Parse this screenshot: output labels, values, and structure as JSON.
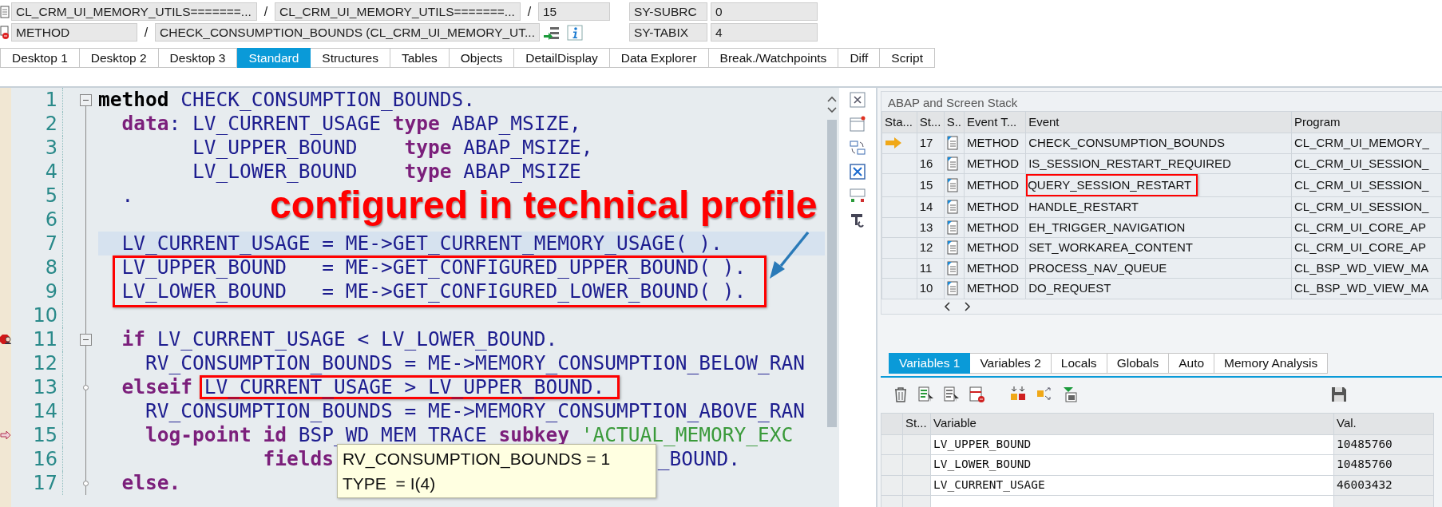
{
  "header": [
    {
      "items": [
        {
          "kind": "field",
          "text": "CL_CRM_UI_MEMORY_UTILS=======..."
        },
        {
          "kind": "sep",
          "text": "/"
        },
        {
          "kind": "field",
          "text": "CL_CRM_UI_MEMORY_UTILS=======..."
        },
        {
          "kind": "sep",
          "text": "/"
        },
        {
          "kind": "short",
          "text": "15"
        }
      ],
      "sys_label": "SY-SUBRC",
      "sys_value": "0"
    },
    {
      "items": [
        {
          "kind": "medium",
          "text": "METHOD"
        },
        {
          "kind": "sep",
          "text": "/"
        },
        {
          "kind": "wide",
          "text": "CHECK_CONSUMPTION_BOUNDS (CL_CRM_UI_MEMORY_UT..."
        },
        {
          "kind": "tools"
        }
      ],
      "sys_label": "SY-TABIX",
      "sys_value": "4"
    }
  ],
  "tabs": [
    {
      "label": "Desktop 1",
      "selected": false
    },
    {
      "label": "Desktop 2",
      "selected": false
    },
    {
      "label": "Desktop 3",
      "selected": false
    },
    {
      "label": "Standard",
      "selected": true
    },
    {
      "label": "Structures",
      "selected": false
    },
    {
      "label": "Tables",
      "selected": false
    },
    {
      "label": "Objects",
      "selected": false
    },
    {
      "label": "DetailDisplay",
      "selected": false
    },
    {
      "label": "Data Explorer",
      "selected": false
    },
    {
      "label": "Break./Watchpoints",
      "selected": false
    },
    {
      "label": "Diff",
      "selected": false
    },
    {
      "label": "Script",
      "selected": false
    }
  ],
  "code": {
    "lines": [
      {
        "num": "1",
        "current": false,
        "boxed": false,
        "fold_open": true,
        "fold_branch": false,
        "breakpoint": false,
        "logpoint": false,
        "segments": [
          {
            "kind": "kw0",
            "text": "method"
          },
          {
            "kind": "id",
            "text": " CHECK_CONSUMPTION_BOUNDS."
          }
        ]
      },
      {
        "num": "2",
        "current": false,
        "boxed": false,
        "fold_open": false,
        "fold_branch": false,
        "breakpoint": false,
        "logpoint": false,
        "segments": [
          {
            "kind": "kw",
            "text": "  data"
          },
          {
            "kind": "id",
            "text": ": LV_CURRENT_USAGE "
          },
          {
            "kind": "kw",
            "text": "type"
          },
          {
            "kind": "id",
            "text": " ABAP_MSIZE,"
          }
        ]
      },
      {
        "num": "3",
        "current": false,
        "boxed": false,
        "fold_open": false,
        "fold_branch": false,
        "breakpoint": false,
        "logpoint": false,
        "segments": [
          {
            "kind": "id",
            "text": "        LV_UPPER_BOUND    "
          },
          {
            "kind": "kw",
            "text": "type"
          },
          {
            "kind": "id",
            "text": " ABAP_MSIZE,"
          }
        ]
      },
      {
        "num": "4",
        "current": false,
        "boxed": false,
        "fold_open": false,
        "fold_branch": false,
        "breakpoint": false,
        "logpoint": false,
        "segments": [
          {
            "kind": "id",
            "text": "        LV_LOWER_BOUND    "
          },
          {
            "kind": "kw",
            "text": "type"
          },
          {
            "kind": "id",
            "text": " ABAP_MSIZE"
          }
        ]
      },
      {
        "num": "5",
        "current": false,
        "boxed": false,
        "fold_open": false,
        "fold_branch": false,
        "breakpoint": false,
        "logpoint": false,
        "segments": [
          {
            "kind": "id",
            "text": "  ."
          }
        ]
      },
      {
        "num": "6",
        "current": false,
        "boxed": false,
        "fold_open": false,
        "fold_branch": false,
        "breakpoint": false,
        "logpoint": false
      },
      {
        "num": "7",
        "current": true,
        "boxed": false,
        "fold_open": false,
        "fold_branch": false,
        "breakpoint": false,
        "logpoint": false,
        "segments": [
          {
            "kind": "id",
            "text": "  LV_CURRENT_USAGE = ME->GET_CURRENT_MEMORY_USAGE( )."
          }
        ]
      },
      {
        "num": "8",
        "current": false,
        "boxed": true,
        "fold_open": false,
        "fold_branch": false,
        "breakpoint": false,
        "logpoint": false,
        "segments": [
          {
            "kind": "id",
            "text": "  LV_UPPER_BOUND   = ME->GET_CONFIGURED_UPPER_BOUND( )."
          }
        ]
      },
      {
        "num": "9",
        "current": false,
        "boxed": true,
        "fold_open": false,
        "fold_branch": false,
        "breakpoint": false,
        "logpoint": false,
        "segments": [
          {
            "kind": "id",
            "text": "  LV_LOWER_BOUND   = ME->GET_CONFIGURED_LOWER_BOUND( )."
          }
        ]
      },
      {
        "num": "10",
        "current": false,
        "boxed": false,
        "fold_open": false,
        "fold_branch": false,
        "breakpoint": false,
        "logpoint": false
      },
      {
        "num": "11",
        "current": false,
        "boxed": false,
        "fold_open": true,
        "fold_branch": false,
        "breakpoint": true,
        "logpoint": false,
        "segments": [
          {
            "kind": "kw",
            "text": "  if"
          },
          {
            "kind": "id",
            "text": " LV_CURRENT_USAGE < LV_LOWER_BOUND."
          }
        ]
      },
      {
        "num": "12",
        "current": false,
        "boxed": false,
        "fold_open": false,
        "fold_branch": false,
        "breakpoint": false,
        "logpoint": false,
        "segments": [
          {
            "kind": "id",
            "text": "    RV_CONSUMPTION_BOUNDS = ME->MEMORY_CONSUMPTION_BELOW_RAN"
          }
        ]
      },
      {
        "num": "13",
        "current": false,
        "boxed": false,
        "fold_open": false,
        "fold_branch": true,
        "breakpoint": false,
        "logpoint": false,
        "segments": [
          {
            "kind": "kw",
            "text": "  elseif "
          },
          {
            "kind": "id",
            "text": "LV_CURRENT_USAGE > LV_UPPER_BOUND.",
            "boxed": true
          }
        ]
      },
      {
        "num": "14",
        "current": false,
        "boxed": false,
        "fold_open": false,
        "fold_branch": false,
        "breakpoint": false,
        "logpoint": false,
        "segments": [
          {
            "kind": "id",
            "text": "    RV_CONSUMPTION_BOUNDS = ME->MEMORY_CONSUMPTION_ABOVE_RAN"
          }
        ]
      },
      {
        "num": "15",
        "current": false,
        "boxed": false,
        "fold_open": false,
        "fold_branch": false,
        "breakpoint": false,
        "logpoint": true,
        "segments": [
          {
            "kind": "kw",
            "text": "    log-point id"
          },
          {
            "kind": "id",
            "text": " BSP_WD_MEM_TRACE "
          },
          {
            "kind": "kw",
            "text": "subkey"
          },
          {
            "kind": "str",
            "text": " 'ACTUAL_MEMORY_EXC"
          }
        ]
      },
      {
        "num": "16",
        "current": false,
        "boxed": false,
        "fold_open": false,
        "fold_branch": false,
        "breakpoint": false,
        "logpoint": false,
        "segments": [
          {
            "kind": "kw",
            "text": "              fields"
          }
        ],
        "tooltip": [
          "RV_CONSUMPTION_BOUNDS = 1",
          "TYPE  = I(4)"
        ],
        "segments_after": [
          {
            "kind": "id",
            "text": "_BOUND."
          }
        ]
      },
      {
        "num": "17",
        "current": false,
        "boxed": false,
        "fold_open": false,
        "fold_branch": true,
        "breakpoint": false,
        "logpoint": false,
        "segments": [
          {
            "kind": "kw",
            "text": "  else."
          }
        ]
      }
    ]
  },
  "annotation": {
    "text": "configured in technical profile"
  },
  "stack": {
    "title": "ABAP and Screen Stack",
    "columns": [
      "Sta...",
      "St...",
      "S..",
      "Event T...",
      "Event",
      "Program"
    ],
    "rows": [
      {
        "current": true,
        "stack_level": "17",
        "event_type": "METHOD",
        "event": "CHECK_CONSUMPTION_BOUNDS",
        "program": "CL_CRM_UI_MEMORY_",
        "boxed": false
      },
      {
        "current": false,
        "stack_level": "16",
        "event_type": "METHOD",
        "event": "IS_SESSION_RESTART_REQUIRED",
        "program": "CL_CRM_UI_SESSION_",
        "boxed": false
      },
      {
        "current": false,
        "stack_level": "15",
        "event_type": "METHOD",
        "event": "QUERY_SESSION_RESTART",
        "program": "CL_CRM_UI_SESSION_",
        "boxed": true
      },
      {
        "current": false,
        "stack_level": "14",
        "event_type": "METHOD",
        "event": "HANDLE_RESTART",
        "program": "CL_CRM_UI_SESSION_",
        "boxed": false
      },
      {
        "current": false,
        "stack_level": "13",
        "event_type": "METHOD",
        "event": "EH_TRIGGER_NAVIGATION",
        "program": "CL_CRM_UI_CORE_AP",
        "boxed": false
      },
      {
        "current": false,
        "stack_level": "12",
        "event_type": "METHOD",
        "event": "SET_WORKAREA_CONTENT",
        "program": "CL_CRM_UI_CORE_AP",
        "boxed": false
      },
      {
        "current": false,
        "stack_level": "11",
        "event_type": "METHOD",
        "event": "PROCESS_NAV_QUEUE",
        "program": "CL_BSP_WD_VIEW_MA",
        "boxed": false
      },
      {
        "current": false,
        "stack_level": "10",
        "event_type": "METHOD",
        "event": "DO_REQUEST",
        "program": "CL_BSP_WD_VIEW_MA",
        "boxed": false
      }
    ]
  },
  "variables": {
    "tabs": [
      {
        "label": "Variables 1",
        "selected": true
      },
      {
        "label": "Variables 2",
        "selected": false
      },
      {
        "label": "Locals",
        "selected": false
      },
      {
        "label": "Globals",
        "selected": false
      },
      {
        "label": "Auto",
        "selected": false
      },
      {
        "label": "Memory Analysis",
        "selected": false
      }
    ],
    "columns": [
      "St...",
      "Variable",
      "Val."
    ],
    "rows": [
      {
        "name": "LV_UPPER_BOUND",
        "value": "10485760"
      },
      {
        "name": "LV_LOWER_BOUND",
        "value": "10485760"
      },
      {
        "name": "LV_CURRENT_USAGE",
        "value": "46003432"
      }
    ]
  }
}
